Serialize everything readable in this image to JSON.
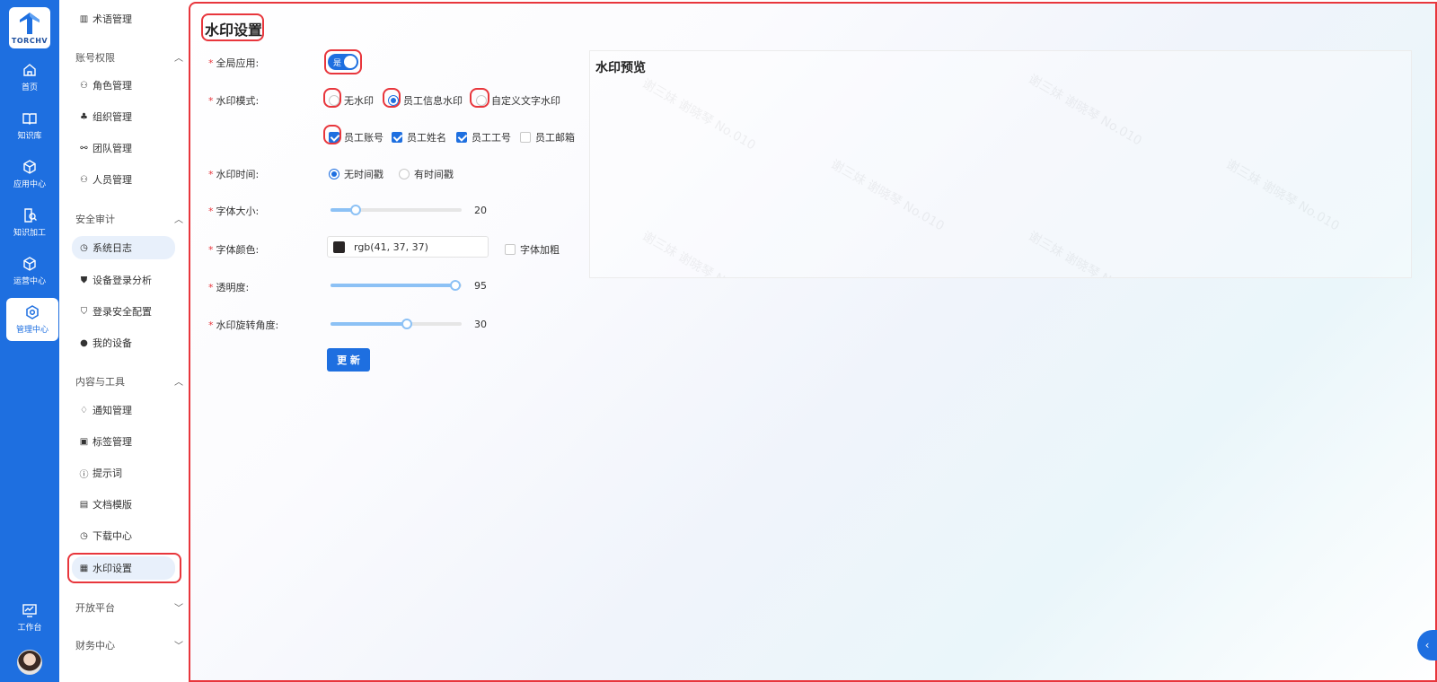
{
  "logo": {
    "text": "TORCHV"
  },
  "rail": {
    "items": [
      {
        "label": "首页",
        "icon": "home-icon"
      },
      {
        "label": "知识库",
        "icon": "book-icon"
      },
      {
        "label": "应用中心",
        "icon": "cube-icon"
      },
      {
        "label": "知识加工",
        "icon": "doc-search-icon"
      },
      {
        "label": "运营中心",
        "icon": "cube-icon"
      },
      {
        "label": "管理中心",
        "icon": "gear-icon"
      },
      {
        "label": "工作台",
        "icon": "monitor-icon"
      }
    ],
    "active": "管理中心"
  },
  "menu": {
    "top_item": "术语管理",
    "groups": [
      {
        "title": "账号权限",
        "items": [
          "角色管理",
          "组织管理",
          "团队管理",
          "人员管理"
        ]
      },
      {
        "title": "安全审计",
        "items": [
          "系统日志",
          "设备登录分析",
          "登录安全配置",
          "我的设备"
        ]
      },
      {
        "title": "内容与工具",
        "items": [
          "通知管理",
          "标签管理",
          "提示词",
          "文档模版",
          "下载中心",
          "水印设置"
        ]
      },
      {
        "title": "开放平台",
        "items": []
      },
      {
        "title": "财务中心",
        "items": []
      }
    ],
    "selected": "水印设置"
  },
  "page": {
    "title": "水印设置",
    "labels": {
      "global_apply": "全局应用:",
      "mode": "水印模式:",
      "time": "水印时间:",
      "font_size": "字体大小:",
      "font_color": "字体颜色:",
      "opacity": "透明度:",
      "rotation": "水印旋转角度:"
    },
    "global_switch": {
      "label": "是",
      "on": true
    },
    "mode_options": [
      "无水印",
      "员工信息水印",
      "自定义文字水印"
    ],
    "mode_selected": 1,
    "info_fields": [
      {
        "label": "员工账号",
        "checked": true
      },
      {
        "label": "员工姓名",
        "checked": true
      },
      {
        "label": "员工工号",
        "checked": true
      },
      {
        "label": "员工邮箱",
        "checked": false
      }
    ],
    "time_options": [
      "无时间戳",
      "有时间戳"
    ],
    "time_selected": 0,
    "font_size": {
      "value": "20",
      "fraction": 0.19
    },
    "font_color": {
      "text": "rgb(41, 37, 37)",
      "hex": "#292525"
    },
    "bold_label": "字体加粗",
    "opacity": {
      "value": "95",
      "fraction": 0.95
    },
    "rotation": {
      "value": "30",
      "fraction": 0.58
    },
    "update_button": "更 新"
  },
  "preview": {
    "title": "水印预览",
    "watermark_text": "谢三妹 谢晓琴 No.010"
  },
  "colors": {
    "primary": "#1e6fe0",
    "highlight": "#e8363c"
  }
}
